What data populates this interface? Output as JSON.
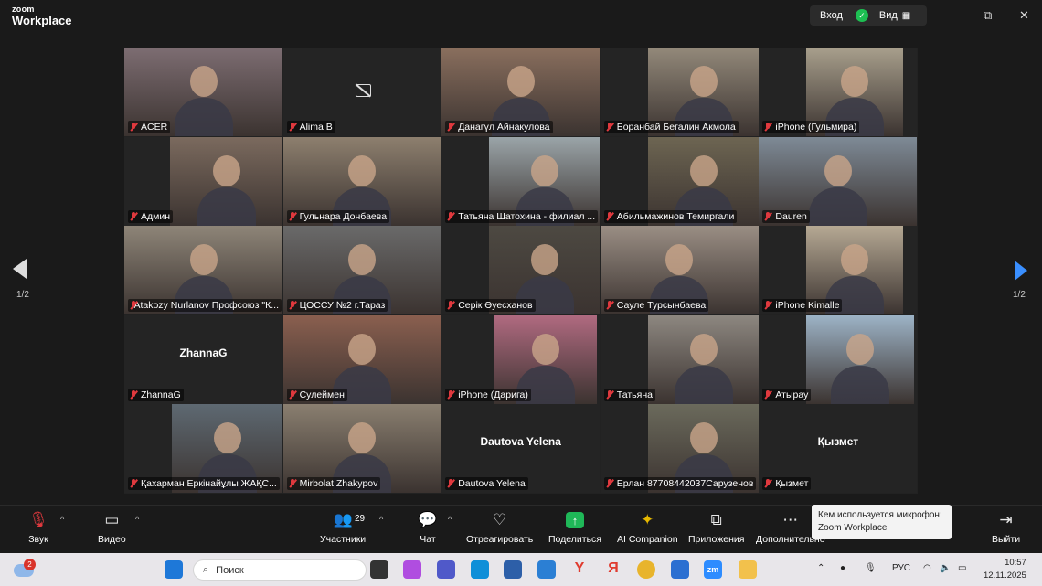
{
  "titlebar": {
    "logo_line1": "zoom",
    "logo_line2": "Workplace",
    "enter": "Вход",
    "view": "Вид",
    "minimize": "—",
    "restore": "⧉",
    "close": "✕"
  },
  "pager": {
    "left": "1/2",
    "right": "1/2"
  },
  "participants": [
    {
      "name": "ACER"
    },
    {
      "name": "Alima B"
    },
    {
      "name": "Данагүл Айнакулова"
    },
    {
      "name": "Боранбай Бегалин Акмола"
    },
    {
      "name": "iPhone (Гульмира)"
    },
    {
      "name": "Админ"
    },
    {
      "name": "Гульнара Донбаева"
    },
    {
      "name": "Татьяна Шатохина - филиал ..."
    },
    {
      "name": "Абильмажинов Темиргали"
    },
    {
      "name": "Dauren"
    },
    {
      "name": "Atakozy Nurlanov Профсоюз \"К..."
    },
    {
      "name": "ЦОССУ №2 г.Тараз"
    },
    {
      "name": "Серік Әуесханов"
    },
    {
      "name": "Сауле Турсынбаева"
    },
    {
      "name": "iPhone Kimalle"
    },
    {
      "name": "ZhannaG",
      "big": "ZhannaG"
    },
    {
      "name": "Сулеймен"
    },
    {
      "name": "iPhone (Дарига)"
    },
    {
      "name": "Татьяна"
    },
    {
      "name": "Атырау"
    },
    {
      "name": "Қахарман Еркінайұлы ЖАҚС..."
    },
    {
      "name": "Mirbolat Zhakypov"
    },
    {
      "name": "Dautova Yelena",
      "big": "Dautova Yelena"
    },
    {
      "name": "Ерлан 87708442037Сарузенов"
    },
    {
      "name": "Қызмет",
      "big": "Қызмет"
    }
  ],
  "controls": {
    "audio": "Звук",
    "video": "Видео",
    "participants": "Участники",
    "participants_count": "29",
    "chat": "Чат",
    "react": "Отреагировать",
    "share": "Поделиться",
    "ai": "AI Companion",
    "apps": "Приложения",
    "more": "Дополнительно",
    "leave": "Выйти"
  },
  "tooltip": {
    "line1": "Кем используется микрофон:",
    "line2": "Zoom Workplace"
  },
  "taskbar": {
    "search": "Поиск",
    "weather_badge": "2",
    "lang": "РУС",
    "time": "10:57",
    "date": "12.11.2025"
  }
}
